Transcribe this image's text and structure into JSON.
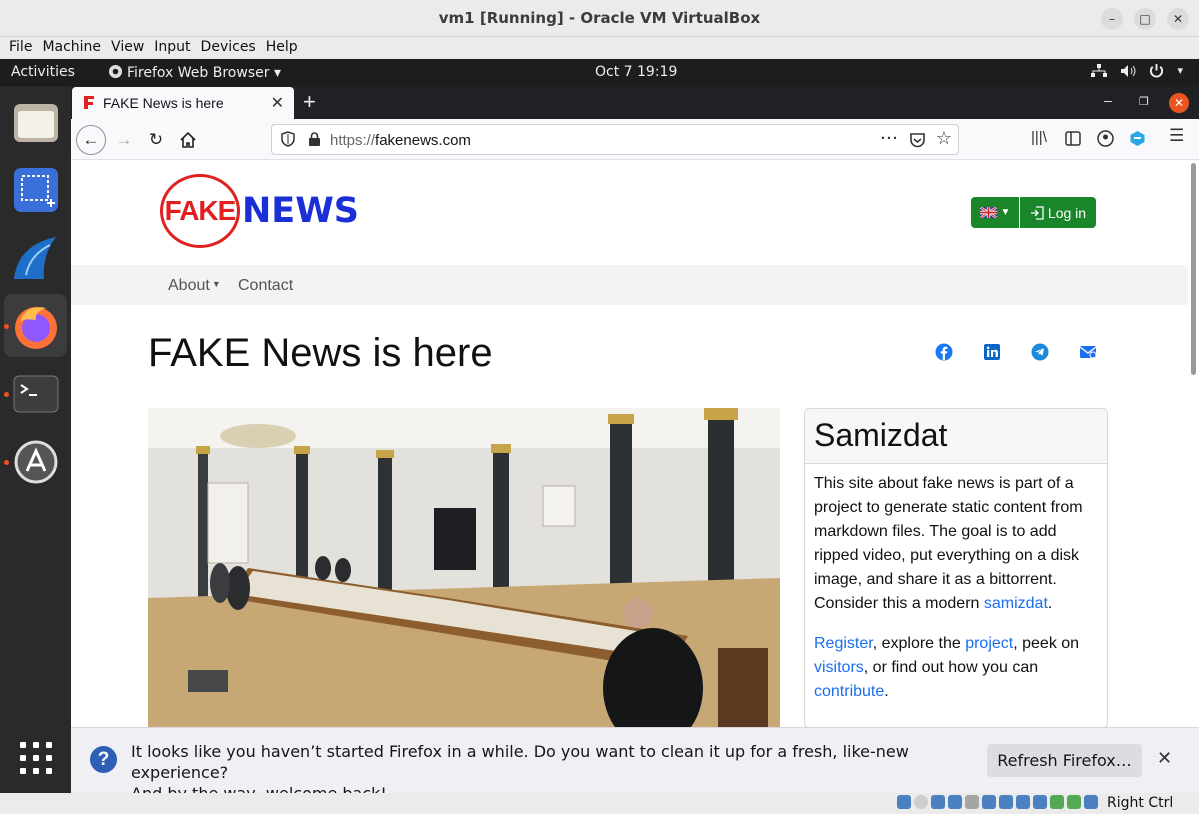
{
  "vbox": {
    "title": "vm1 [Running] - Oracle VM VirtualBox",
    "menu": [
      "File",
      "Machine",
      "View",
      "Input",
      "Devices",
      "Help"
    ],
    "host_key": "Right Ctrl"
  },
  "gnome": {
    "activities": "Activities",
    "app": "Firefox Web Browser ▾",
    "clock": "Oct 7  19:19"
  },
  "dock": {
    "items": [
      "files-icon",
      "screenshot-icon",
      "wireshark-icon",
      "firefox-icon",
      "terminal-icon",
      "software-updater-icon",
      "show-apps-icon"
    ]
  },
  "firefox": {
    "tab_title": "FAKE News is here",
    "url_prefix": "https://",
    "url_host": "fakenews.com"
  },
  "site": {
    "logo_fake": "FAKE",
    "logo_news": "NEWS",
    "login": "Log in",
    "nav": {
      "about": "About",
      "contact": "Contact"
    },
    "heading": "FAKE News is here",
    "sidebar": {
      "title": "Samizdat",
      "p1_text": "This site about fake news is part of a project to generate static content from markdown files. The goal is to add ripped video, put everything on a disk image, and share it as a bittorrent. Consider this a modern ",
      "p1_link": "samizdat",
      "p1_end": ".",
      "register": "Register",
      "t1": ", explore the ",
      "project": "project",
      "t2": ", peek on ",
      "visitors": "visitors",
      "t3": ", or find out how you can ",
      "contribute": "contribute",
      "t4": "."
    }
  },
  "notification": {
    "line1": "It looks like you haven’t started Firefox in a while. Do you want to clean it up for a fresh, like-new experience?",
    "line2": "And by the way, welcome back!",
    "button": "Refresh Firefox…"
  },
  "colors": {
    "green_button": "#198729",
    "link_blue": "#1a6ef0",
    "logo_red": "#e01f1f",
    "logo_blue": "#1a2fd6",
    "ubuntu_orange": "#e95420"
  }
}
